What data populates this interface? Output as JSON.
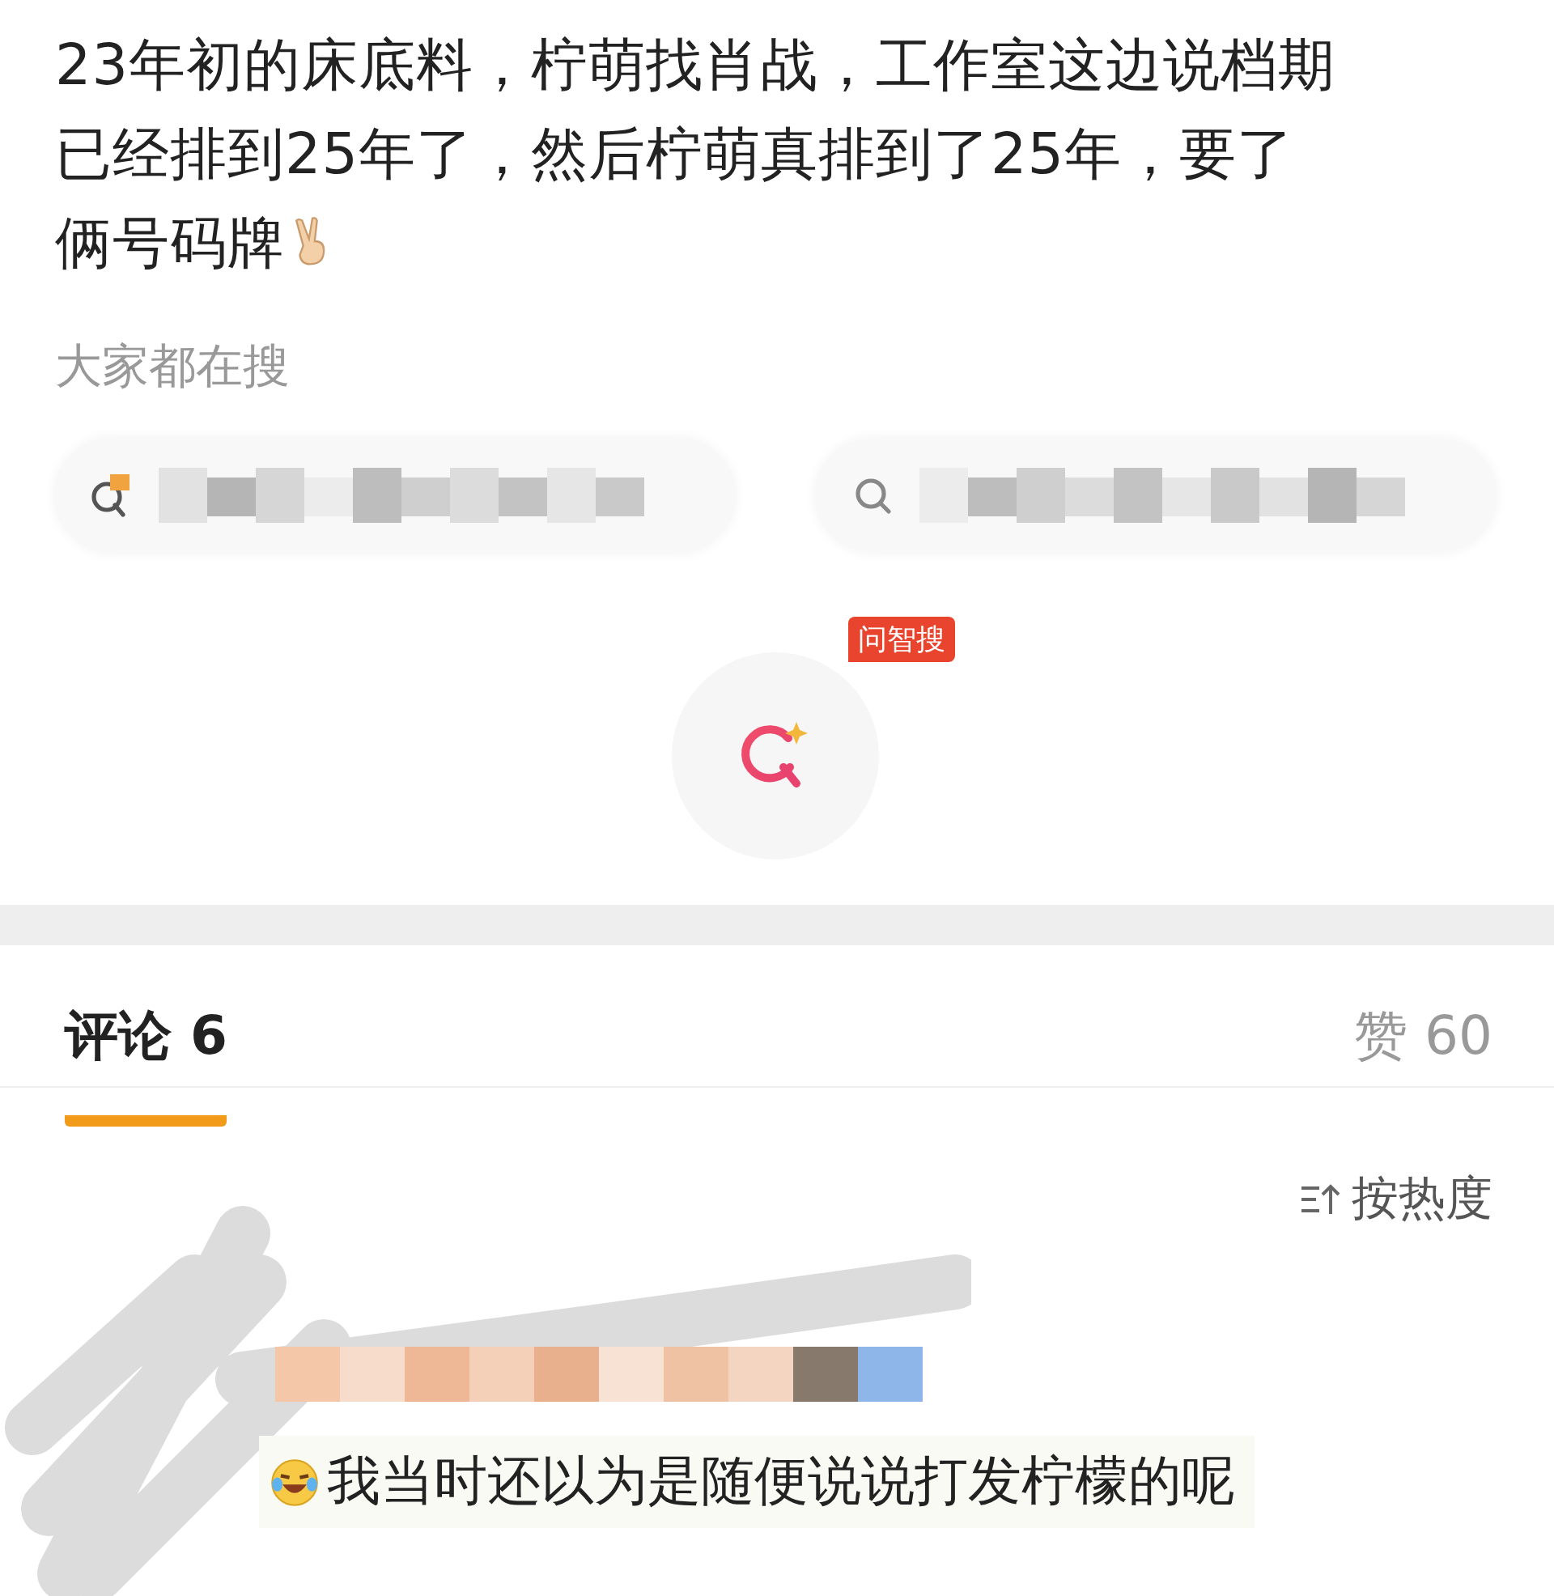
{
  "post": {
    "lines": [
      "23年初的床底料，柠萌找肖战，工作室这边说档期",
      "已经排到25年了，然后柠萌真排到了25年，要了",
      "俩号码牌"
    ]
  },
  "search_section": {
    "title": "大家都在搜",
    "chips": [
      {
        "kind": "hot"
      },
      {
        "kind": "plain"
      }
    ],
    "ask_badge": "问智搜"
  },
  "tabs": [
    {
      "label": "评论 6",
      "selected": true
    },
    {
      "label": "赞 60",
      "selected": false
    }
  ],
  "sort": {
    "label": "按热度"
  },
  "comments": [
    {
      "text": "我当时还以为是随便说说打发柠檬的呢"
    }
  ]
}
